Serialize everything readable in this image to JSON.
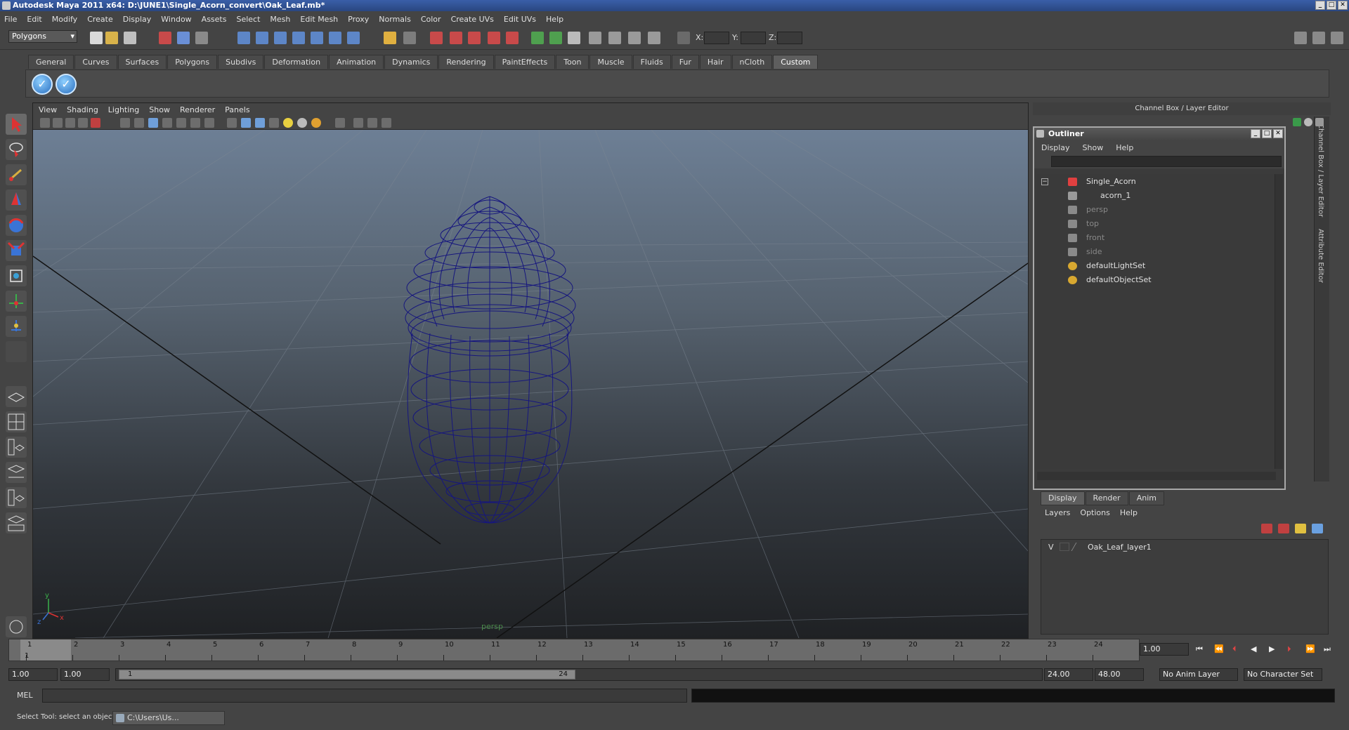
{
  "window": {
    "title": "Autodesk Maya 2011 x64: D:\\JUNE1\\Single_Acorn_convert\\Oak_Leaf.mb*",
    "min": "_",
    "max": "□",
    "close": "✕"
  },
  "menubar": [
    "File",
    "Edit",
    "Modify",
    "Create",
    "Display",
    "Window",
    "Assets",
    "Select",
    "Mesh",
    "Edit Mesh",
    "Proxy",
    "Normals",
    "Color",
    "Create UVs",
    "Edit UVs",
    "Help"
  ],
  "status": {
    "menuset": "Polygons",
    "x_label": "X:",
    "y_label": "Y:",
    "z_label": "Z:"
  },
  "shelf": {
    "tabs": [
      "General",
      "Curves",
      "Surfaces",
      "Polygons",
      "Subdivs",
      "Deformation",
      "Animation",
      "Dynamics",
      "Rendering",
      "PaintEffects",
      "Toon",
      "Muscle",
      "Fluids",
      "Fur",
      "Hair",
      "nCloth",
      "Custom"
    ],
    "active": "Custom"
  },
  "viewport": {
    "menu": [
      "View",
      "Shading",
      "Lighting",
      "Show",
      "Renderer",
      "Panels"
    ],
    "camera_label": "persp",
    "axis_y": "y",
    "axis_x": "x",
    "axis_z": "z",
    "wire_color": "#1a1a8c"
  },
  "channel_box": {
    "title": "Channel Box / Layer Editor",
    "side_tabs": [
      "Channel Box / Layer Editor",
      "Attribute Editor"
    ]
  },
  "outliner": {
    "title": "Outliner",
    "menu": [
      "Display",
      "Show",
      "Help"
    ],
    "items": [
      {
        "label": "Single_Acorn",
        "icon": "transform-icon",
        "dim": false
      },
      {
        "label": "acorn_1",
        "icon": "mesh-icon",
        "dim": false
      },
      {
        "label": "persp",
        "icon": "camera-icon",
        "dim": true
      },
      {
        "label": "top",
        "icon": "camera-icon",
        "dim": true
      },
      {
        "label": "front",
        "icon": "camera-icon",
        "dim": true
      },
      {
        "label": "side",
        "icon": "camera-icon",
        "dim": true
      },
      {
        "label": "defaultLightSet",
        "icon": "set-icon",
        "dim": false
      },
      {
        "label": "defaultObjectSet",
        "icon": "set-icon",
        "dim": false
      }
    ]
  },
  "layer_editor": {
    "tabs": [
      "Display",
      "Render",
      "Anim"
    ],
    "active": "Display",
    "menu": [
      "Layers",
      "Options",
      "Help"
    ],
    "layer": {
      "visible": "V",
      "name": "Oak_Leaf_layer1"
    }
  },
  "timeline": {
    "frames": [
      "1",
      "2",
      "3",
      "4",
      "5",
      "6",
      "7",
      "8",
      "9",
      "10",
      "11",
      "12",
      "13",
      "14",
      "15",
      "16",
      "17",
      "18",
      "19",
      "20",
      "21",
      "22",
      "23",
      "24"
    ],
    "current_frame": "1",
    "current_time": "1.00"
  },
  "range": {
    "start": "1.00",
    "start2": "1.00",
    "inner_start": "1",
    "inner_end": "24",
    "end": "24.00",
    "end2": "48.00",
    "anim_layer": "No Anim Layer",
    "char_set": "No Character Set"
  },
  "command": {
    "label": "MEL"
  },
  "help": {
    "text": "Select Tool: select an object",
    "taskbar_item": "C:\\Users\\Us..."
  }
}
